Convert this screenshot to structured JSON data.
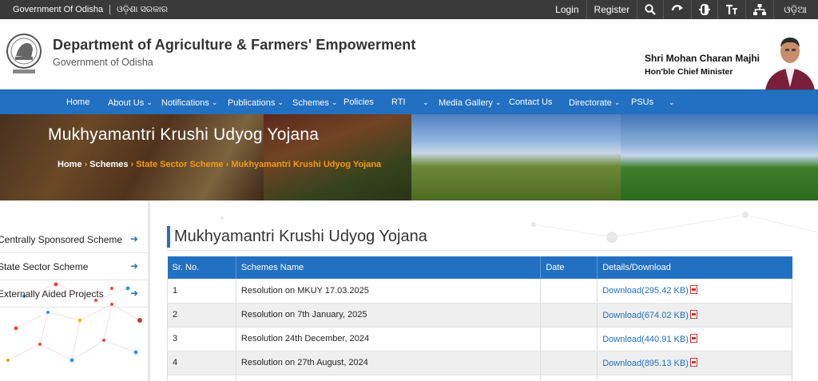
{
  "topbar": {
    "gov_label": "Government Of Odisha",
    "gov_label_odia": "ଓଡ଼ିଶା ସରକାର",
    "login": "Login",
    "register": "Register",
    "language": "ଓଡ଼ିଆ",
    "icons": [
      "search-icon",
      "refresh-icon",
      "contrast-icon",
      "text-size-icon",
      "sitemap-icon"
    ]
  },
  "header": {
    "title": "Department of Agriculture & Farmers' Empowerment",
    "subtitle": "Government of Odisha",
    "cm_name": "Shri Mohan Charan Majhi",
    "cm_role": "Hon'ble Chief Minister"
  },
  "nav": {
    "items": [
      {
        "label": "Home",
        "dropdown": false
      },
      {
        "label": "About Us",
        "dropdown": true
      },
      {
        "label": "Notifications",
        "dropdown": true
      },
      {
        "label": "Publications",
        "dropdown": true
      },
      {
        "label": "Schemes",
        "dropdown": true
      },
      {
        "label": "Policies",
        "dropdown": false
      },
      {
        "label": "RTI",
        "dropdown": false
      },
      {
        "label": "",
        "dropdown": true
      },
      {
        "label": "Media Gallery",
        "dropdown": true
      },
      {
        "label": "Contact Us",
        "dropdown": false
      },
      {
        "label": "Directorate",
        "dropdown": true
      },
      {
        "label": "PSUs",
        "dropdown": false
      },
      {
        "label": "",
        "dropdown": true
      }
    ]
  },
  "banner": {
    "title": "Mukhyamantri Krushi Udyog Yojana",
    "breadcrumb": [
      "Home",
      "Schemes",
      "State Sector Scheme",
      "Mukhyamantri Krushi Udyog Yojana"
    ]
  },
  "sidebar": {
    "items": [
      {
        "label": "Centrally Sponsored Scheme"
      },
      {
        "label": "State Sector Scheme"
      },
      {
        "label": "Externally Aided Projects"
      }
    ]
  },
  "main": {
    "title": "Mukhyamantri Krushi Udyog Yojana",
    "columns": [
      "Sr. No.",
      "Schemes Name",
      "Date",
      "Details/Download"
    ],
    "rows": [
      {
        "sr": "1",
        "name": "Resolution on MKUY 17.03.2025",
        "date": "",
        "download": "Download(295.42 KB)"
      },
      {
        "sr": "2",
        "name": "Resolution on 7th January, 2025",
        "date": "",
        "download": "Download(674.02 KB)"
      },
      {
        "sr": "3",
        "name": "Resolution 24th December, 2024",
        "date": "",
        "download": "Download(440.91 KB)"
      },
      {
        "sr": "4",
        "name": "Resolution on 27th August, 2024",
        "date": "",
        "download": "Download(895.13 KB)"
      },
      {
        "sr": "",
        "name": "",
        "date": "",
        "download": ""
      }
    ]
  },
  "colors": {
    "topbar_bg": "#3a3a3a",
    "nav_bg": "#2270c2",
    "accent_orange": "#f39c12",
    "link_blue": "#1e6fc1"
  }
}
